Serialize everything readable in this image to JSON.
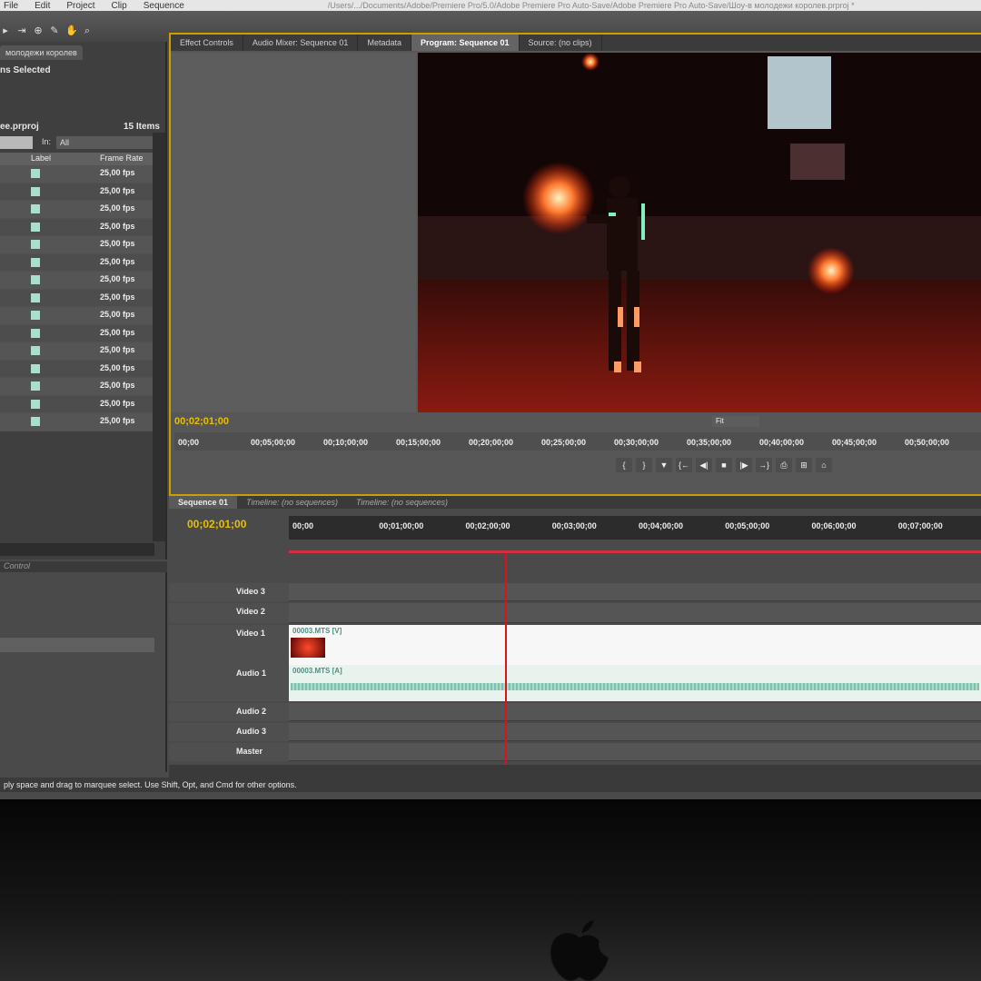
{
  "menubar": {
    "items": [
      "File",
      "Edit",
      "Project",
      "Clip",
      "Sequence"
    ],
    "path": "/Users/.../Documents/Adobe/Premiere Pro/5.0/Adobe Premiere Pro Auto-Save/Adobe Premiere Pro Auto-Save/Шоу-в молодежи королев.prproj *"
  },
  "project": {
    "tab_label": "молодежи королев",
    "selection_info": "ns Selected",
    "project_name": "ee.prproj",
    "item_count": "15 Items",
    "in_label": "In:",
    "in_value": "All",
    "columns": {
      "label": "Label",
      "frame_rate": "Frame Rate"
    },
    "rows": [
      "25,00 fps",
      "25,00 fps",
      "25,00 fps",
      "25,00 fps",
      "25,00 fps",
      "25,00 fps",
      "25,00 fps",
      "25,00 fps",
      "25,00 fps",
      "25,00 fps",
      "25,00 fps",
      "25,00 fps",
      "25,00 fps",
      "25,00 fps",
      "25,00 fps"
    ],
    "label_color": "#a9dfcd"
  },
  "lower_left": {
    "tab_label": "Control"
  },
  "monitor": {
    "tabs": [
      "Effect Controls",
      "Audio Mixer: Sequence 01",
      "Metadata",
      "Program: Sequence 01",
      "Source: (no clips)"
    ],
    "active_tab": "Program: Sequence 01",
    "timecode": "00;02;01;00",
    "fit": "Fit",
    "ruler": [
      "00;00",
      "00;05;00;00",
      "00;10;00;00",
      "00;15;00;00",
      "00;20;00;00",
      "00;25;00;00",
      "00;30;00;00",
      "00;35;00;00",
      "00;40;00;00",
      "00;45;00;00",
      "00;50;00;00"
    ]
  },
  "timeline": {
    "tabs": [
      "Sequence 01",
      "Timeline: (no sequences)",
      "Timeline: (no sequences)"
    ],
    "timecode": "00;02;01;00",
    "ruler": [
      "00;00",
      "00;01;00;00",
      "00;02;00;00",
      "00;03;00;00",
      "00;04;00;00",
      "00;05;00;00",
      "00;06;00;00",
      "00;07;00;00"
    ],
    "tracks": {
      "video3": "Video 3",
      "video2": "Video 2",
      "video1": "Video 1",
      "audio1": "Audio 1",
      "audio2": "Audio 2",
      "audio3": "Audio 3",
      "master": "Master"
    },
    "video_clip": "00003.MTS [V]",
    "audio_clip": "00003.MTS [A]"
  },
  "status": "ply space and drag to marquee select. Use Shift, Opt, and Cmd for other options.",
  "colors": {
    "accent": "#c9a000",
    "timecode": "#e8c000",
    "playhead": "#e01020"
  }
}
